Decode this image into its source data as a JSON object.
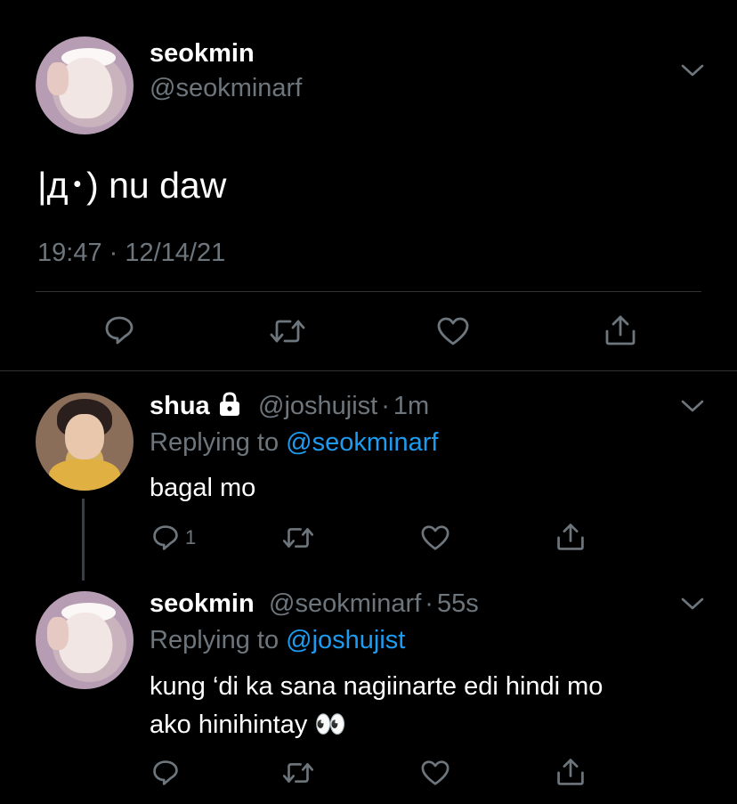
{
  "main_tweet": {
    "display_name": "seokmin",
    "handle": "@seokminarf",
    "text": "|д･) nu daw",
    "timestamp": "19:47 · 12/14/21"
  },
  "replies": [
    {
      "display_name": "shua",
      "handle": "@joshujist",
      "separator": "·",
      "age": "1m",
      "replying_prefix": "Replying to ",
      "replying_to": "@seokminarf",
      "text": "bagal mo",
      "reply_count": "1",
      "locked": true
    },
    {
      "display_name": "seokmin",
      "handle": "@seokminarf",
      "separator": "·",
      "age": "55s",
      "replying_prefix": "Replying to ",
      "replying_to": "@joshujist",
      "text_line1": "kung ‘di ka sana nagiinarte edi hindi mo",
      "text_line2": "ako hinihintay 👀",
      "locked": false
    }
  ],
  "icons": [
    "reply-icon",
    "retweet-icon",
    "like-icon",
    "share-icon",
    "chevron-down-icon",
    "lock-icon"
  ],
  "colors": {
    "background": "#000000",
    "secondary_text": "#6e767d",
    "link": "#1d9bf0",
    "divider": "#2f3336"
  }
}
